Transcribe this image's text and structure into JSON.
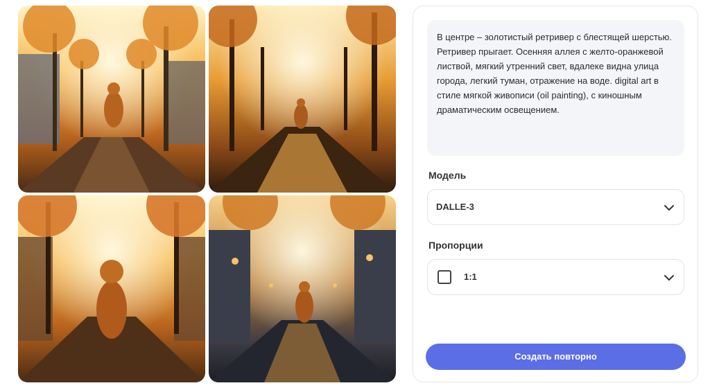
{
  "gallery": {
    "images": [
      {
        "icon": "dog-image"
      },
      {
        "icon": "dog-image"
      },
      {
        "icon": "dog-image"
      },
      {
        "icon": "dog-image"
      }
    ]
  },
  "panel": {
    "prompt": "В центре – золотистый ретривер с блестящей шерстью. Ретривер прыгает. Осенняя аллея с желто-оранжевой листвой, мягкий утренний свет, вдалеке видна улица города, легкий туман, отражение на воде. digital art в стиле мягкой живописи (oil painting), с киношным драматическим освещением.",
    "model_label": "Модель",
    "model_value": "DALLE-3",
    "ratio_label": "Пропорции",
    "ratio_value": "1:1",
    "regenerate_label": "Создать повторно"
  },
  "colors": {
    "accent": "#5b6ee6",
    "prompt_bg": "#f4f5f9",
    "border": "#dfe2e7"
  }
}
